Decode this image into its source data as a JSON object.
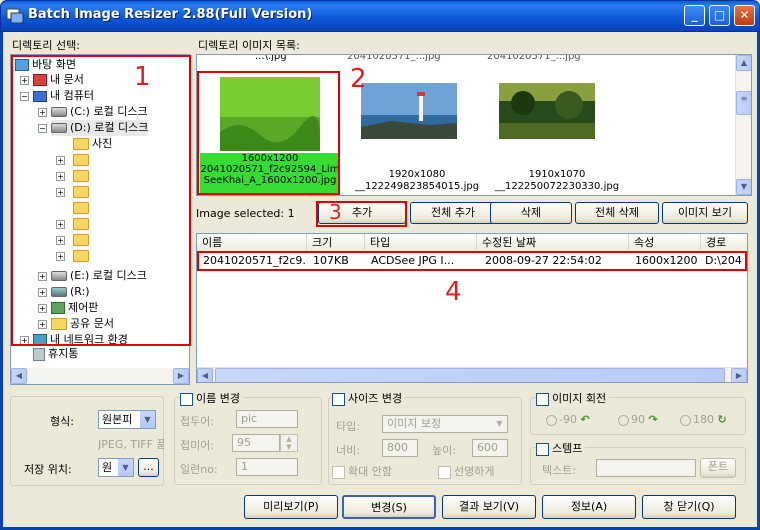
{
  "window": {
    "title": "Batch Image Resizer 2.88(Full Version)",
    "minimize": "_",
    "maximize": "□",
    "close": "✕"
  },
  "tree": {
    "label": "디렉토리 선택:",
    "items": [
      "바탕 화면",
      "내 문서",
      "내 컴퓨터",
      "(C:) 로컬 디스크",
      "(D:) 로컬 디스크",
      "사진",
      "(E:) 로컬 디스크",
      "(R:)",
      "제어판",
      "공유 문서",
      "내 네트워크 환경",
      "휴지통"
    ]
  },
  "images": {
    "label": "디렉토리 이미지 목록:",
    "top_partial": [
      "...\\.jpg",
      "2041020571_...jpg",
      "2041020571_...jpg"
    ],
    "thumbs": [
      {
        "size": "1600x1200",
        "name": "2041020571_f2c92594_LimSeeKhai_A_1600x1200.jpg"
      },
      {
        "size": "1920x1080",
        "name": "__122249823854015.jpg"
      },
      {
        "size": "1910x1070",
        "name": "__122250072230330.jpg"
      }
    ]
  },
  "actions": {
    "selected": "Image selected: 1",
    "add": "추가",
    "add_all": "전체 추가",
    "delete": "삭제",
    "delete_all": "전체 삭제",
    "view_image": "이미지 보기"
  },
  "table": {
    "columns": [
      "이름",
      "크기",
      "타입",
      "수정된 날짜",
      "속성",
      "경로"
    ],
    "rows": [
      [
        "2041020571_f2c9...",
        "107KB",
        "ACDSee JPG I...",
        "2008-09-27 22:54:02",
        "1600x1200",
        "D:\\204"
      ]
    ]
  },
  "annotations": [
    "1",
    "2",
    "3",
    "4"
  ],
  "format": {
    "label": "형식:",
    "value": "원본피",
    "hint": "JPEG, TIFF 품질",
    "save_label": "저장 위치:",
    "save_value": "원",
    "browse": "..."
  },
  "rename": {
    "check_label": "이름 변경",
    "prefix_label": "접두어:",
    "prefix_value": "pic",
    "suffix_label": "접미어:",
    "suffix_value": "95",
    "serial_label": "일련no:",
    "serial_value": "1"
  },
  "resize": {
    "check_label": "사이즈 변경",
    "type_label": "타입:",
    "type_value": "이미지 보정",
    "width_label": "너비:",
    "width_value": "800",
    "height_label": "높이:",
    "height_value": "600",
    "enlarge_label": "확대 안함",
    "sharpen_label": "선명하게"
  },
  "rotate": {
    "check_label": "이미지 회전",
    "opt1": "-90",
    "opt2": "90",
    "opt3": "180"
  },
  "stamp": {
    "check_label": "스템프",
    "text_label": "텍스트:",
    "font_btn": "폰트"
  },
  "bottom": {
    "preview": "미리보기(P)",
    "convert": "변경(S)",
    "result": "결과 보기(V)",
    "info": "정보(A)",
    "close": "창 닫기(Q)"
  },
  "colors": {
    "annotation": "#e00000",
    "selected_caption": "#33dd33"
  }
}
